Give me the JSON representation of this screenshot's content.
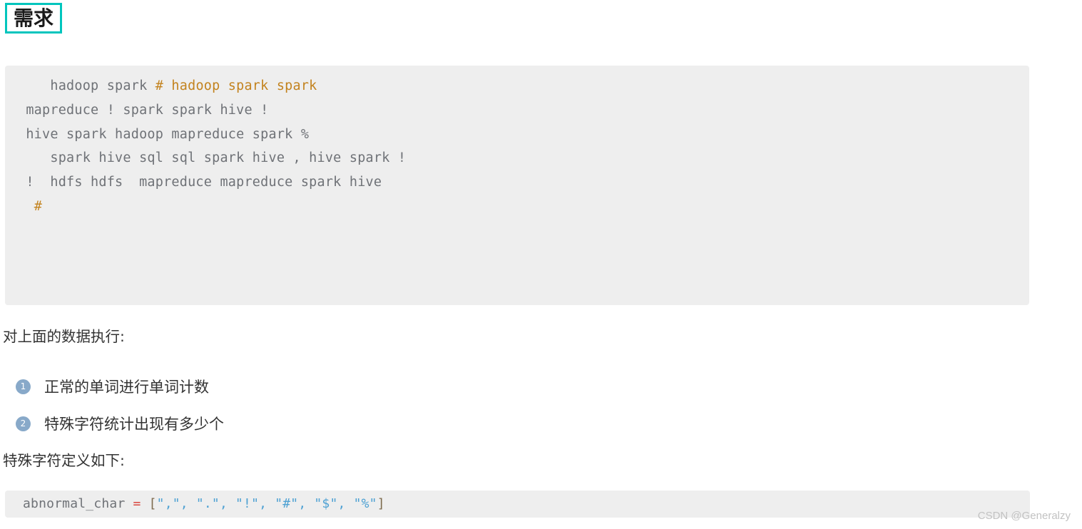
{
  "heading": {
    "text": "需求",
    "border_color": "#00c5bd"
  },
  "code_block_main": {
    "background": "#eeeeee",
    "text_color": "#6f7277",
    "comment_color": "#c3831f",
    "lines": [
      {
        "plain": "    hadoop spark ",
        "comment": "# hadoop spark spark"
      },
      {
        "plain": " mapreduce ! spark spark hive !",
        "comment": ""
      },
      {
        "plain": " hive spark hadoop mapreduce spark %",
        "comment": ""
      },
      {
        "plain": "    spark hive sql sql spark hive , hive spark !",
        "comment": ""
      },
      {
        "plain": " !  hdfs hdfs  mapreduce mapreduce spark hive",
        "comment": ""
      },
      {
        "plain": "",
        "comment": ""
      },
      {
        "plain": "  ",
        "comment": "#"
      },
      {
        "plain": "",
        "comment": ""
      },
      {
        "plain": "",
        "comment": ""
      }
    ]
  },
  "paragraph_exec": "对上面的数据执行:",
  "ordered_list": [
    {
      "number": "1",
      "text": "正常的单词进行单词计数"
    },
    {
      "number": "2",
      "text": "特殊字符统计出现有多少个"
    }
  ],
  "paragraph_definition": "特殊字符定义如下:",
  "code_block_footer": {
    "background": "#eeeeee",
    "variable": "abnormal_char ",
    "operator": "=",
    "open_bracket": " [",
    "strings": "\",\", \".\", \"!\", \"#\", \"$\", \"%\"",
    "close_bracket": "]"
  },
  "watermark": "CSDN @Generalzy"
}
